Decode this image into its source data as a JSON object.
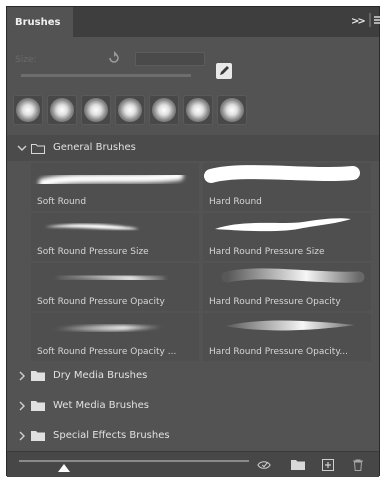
{
  "panel": {
    "tab_label": "Brushes",
    "collapse_icon": "double-chevron-right-icon",
    "menu_icon": "panel-menu-icon"
  },
  "size": {
    "label": "Size:",
    "value": "",
    "reset_icon": "reset-icon",
    "edit_icon": "brush-settings-icon"
  },
  "recent_brushes": {
    "count": 7,
    "icon": "soft-round-brush-preview"
  },
  "groups": [
    {
      "label": "General Brushes",
      "expanded": true,
      "brushes": [
        {
          "name": "Soft Round"
        },
        {
          "name": "Hard Round"
        },
        {
          "name": "Soft Round Pressure Size"
        },
        {
          "name": "Hard Round Pressure Size"
        },
        {
          "name": "Soft Round Pressure Opacity"
        },
        {
          "name": "Hard Round Pressure Opacity"
        },
        {
          "name": "Soft Round Pressure Opacity ..."
        },
        {
          "name": "Hard Round Pressure Opacity..."
        }
      ]
    },
    {
      "label": "Dry Media Brushes",
      "expanded": false
    },
    {
      "label": "Wet Media Brushes",
      "expanded": false
    },
    {
      "label": "Special Effects Brushes",
      "expanded": false
    }
  ],
  "footer": {
    "thumbnail_slider": 0.18,
    "icons": [
      "toggle-preview-icon",
      "new-group-folder-icon",
      "new-brush-icon",
      "trash-icon"
    ]
  },
  "colors": {
    "panel_bg": "#535353",
    "tab_bar": "#3e3e3e",
    "text": "#d8d8d8"
  }
}
